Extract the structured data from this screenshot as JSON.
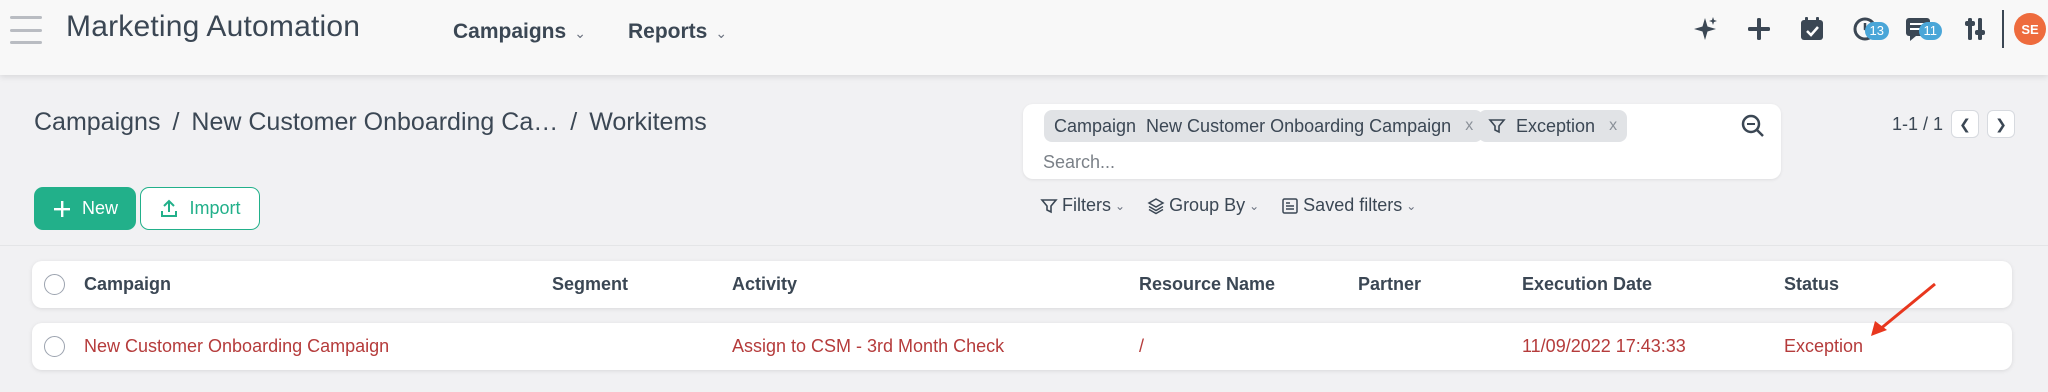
{
  "app": {
    "title": "Marketing Automation"
  },
  "nav": [
    {
      "label": "Campaigns"
    },
    {
      "label": "Reports"
    }
  ],
  "systray": {
    "icons": [
      "sparkle-icon",
      "plus-icon",
      "calendar-check-icon",
      "clock-icon",
      "chat-icon",
      "settings-sliders-icon"
    ],
    "activity_count": "13",
    "messages_count": "11",
    "avatar_initials": "SE"
  },
  "breadcrumb": {
    "items": [
      "Campaigns",
      "New Customer Onboarding Ca…",
      "Workitems"
    ],
    "separator": "/"
  },
  "actions": {
    "new_label": "New",
    "import_label": "Import"
  },
  "search": {
    "facets": [
      {
        "field": "Campaign",
        "value": "New Customer Onboarding Campaign"
      },
      {
        "field": "",
        "value": "Exception",
        "icon": "filter-icon"
      }
    ],
    "placeholder": "Search...",
    "facet_remove": "x"
  },
  "subtools": {
    "filters": "Filters",
    "group_by": "Group By",
    "saved_filters": "Saved filters"
  },
  "pager": {
    "value": "1-1 / 1"
  },
  "table": {
    "columns": [
      "Campaign",
      "Segment",
      "Activity",
      "Resource Name",
      "Partner",
      "Execution Date",
      "Status"
    ],
    "rows": [
      {
        "campaign": "New Customer Onboarding Campaign",
        "segment": "",
        "activity": "Assign to CSM - 3rd Month Check",
        "resource_name": "/",
        "partner": "",
        "execution_date": "11/09/2022 17:43:33",
        "status": "Exception"
      }
    ]
  },
  "colors": {
    "primary": "#22b08a",
    "exception_text": "#b53b3b",
    "annotation_arrow": "#e8371e",
    "avatar": "#ee6b3d",
    "badge": "#4aa6d8"
  }
}
